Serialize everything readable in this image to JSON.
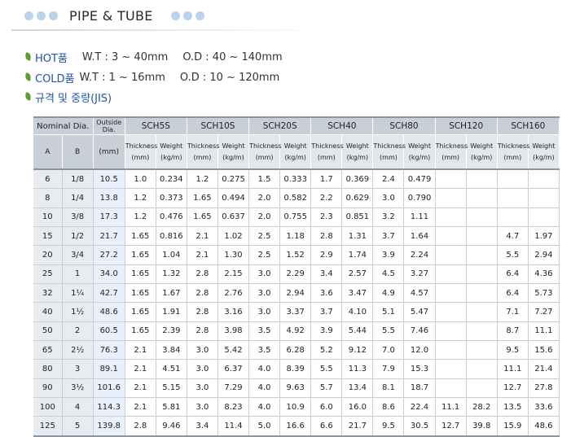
{
  "title": "PIPE & TUBE",
  "specs": {
    "hot": {
      "label": "HOT품",
      "wt": "W.T : 3 ~ 40mm",
      "od": "O.D : 40 ~ 140mm"
    },
    "cold": {
      "label": "COLD품",
      "wt": "W.T : 1 ~ 16mm",
      "od": "O.D : 10 ~ 120mm"
    },
    "jis": {
      "label": "규격 및 중량(JIS)"
    }
  },
  "table": {
    "nominal": "Nominal Dia.",
    "outside": "Outside Dia.",
    "a": "A",
    "b": "B",
    "mm": "(mm)",
    "schedules": [
      "SCH5S",
      "SCH10S",
      "SCH20S",
      "SCH40",
      "SCH80",
      "SCH120",
      "SCH160"
    ],
    "thickness": "Thickness",
    "weight": "Weight",
    "unit_thk": "(mm)",
    "unit_wt": "(kg/m)",
    "rows": [
      [
        "6",
        "1/8",
        "10.5",
        "1.0",
        "0.234",
        "1.2",
        "0.275",
        "1.5",
        "0.333",
        "1.7",
        "0.369",
        "2.4",
        "0.479",
        "",
        "",
        "",
        ""
      ],
      [
        "8",
        "1/4",
        "13.8",
        "1.2",
        "0.373",
        "1.65",
        "0.494",
        "2.0",
        "0.582",
        "2.2",
        "0.629",
        "3.0",
        "0.790",
        "",
        "",
        "",
        ""
      ],
      [
        "10",
        "3/8",
        "17.3",
        "1.2",
        "0.476",
        "1.65",
        "0.637",
        "2.0",
        "0.755",
        "2.3",
        "0.851",
        "3.2",
        "1.11",
        "",
        "",
        "",
        ""
      ],
      [
        "15",
        "1/2",
        "21.7",
        "1.65",
        "0.816",
        "2.1",
        "1.02",
        "2.5",
        "1.18",
        "2.8",
        "1.31",
        "3.7",
        "1.64",
        "",
        "",
        "4.7",
        "1.97"
      ],
      [
        "20",
        "3/4",
        "27.2",
        "1.65",
        "1.04",
        "2.1",
        "1.30",
        "2.5",
        "1.52",
        "2.9",
        "1.74",
        "3.9",
        "2.24",
        "",
        "",
        "5.5",
        "2.94"
      ],
      [
        "25",
        "1",
        "34.0",
        "1.65",
        "1.32",
        "2.8",
        "2.15",
        "3.0",
        "2.29",
        "3.4",
        "2.57",
        "4.5",
        "3.27",
        "",
        "",
        "6.4",
        "4.36"
      ],
      [
        "32",
        "1¼",
        "42.7",
        "1.65",
        "1.67",
        "2.8",
        "2.76",
        "3.0",
        "2.94",
        "3.6",
        "3.47",
        "4.9",
        "4.57",
        "",
        "",
        "6.4",
        "5.73"
      ],
      [
        "40",
        "1½",
        "48.6",
        "1.65",
        "1.91",
        "2.8",
        "3.16",
        "3.0",
        "3.37",
        "3.7",
        "4.10",
        "5.1",
        "5.47",
        "",
        "",
        "7.1",
        "7.27"
      ],
      [
        "50",
        "2",
        "60.5",
        "1.65",
        "2.39",
        "2.8",
        "3.98",
        "3.5",
        "4.92",
        "3.9",
        "5.44",
        "5.5",
        "7.46",
        "",
        "",
        "8.7",
        "11.1"
      ],
      [
        "65",
        "2½",
        "76.3",
        "2.1",
        "3.84",
        "3.0",
        "5.42",
        "3.5",
        "6.28",
        "5.2",
        "9.12",
        "7.0",
        "12.0",
        "",
        "",
        "9.5",
        "15.6"
      ],
      [
        "80",
        "3",
        "89.1",
        "2.1",
        "4.51",
        "3.0",
        "6.37",
        "4.0",
        "8.39",
        "5.5",
        "11.3",
        "7.9",
        "15.3",
        "",
        "",
        "11.1",
        "21.4"
      ],
      [
        "90",
        "3½",
        "101.6",
        "2.1",
        "5.15",
        "3.0",
        "7.29",
        "4.0",
        "9.63",
        "5.7",
        "13.4",
        "8.1",
        "18.7",
        "",
        "",
        "12.7",
        "27.8"
      ],
      [
        "100",
        "4",
        "114.3",
        "2.1",
        "5.81",
        "3.0",
        "8.23",
        "4.0",
        "10.9",
        "6.0",
        "16.0",
        "8.6",
        "22.4",
        "11.1",
        "28.2",
        "13.5",
        "33.6"
      ],
      [
        "125",
        "5",
        "139.8",
        "2.8",
        "9.46",
        "3.4",
        "11.4",
        "5.0",
        "16.6",
        "6.6",
        "21.7",
        "9.5",
        "30.5",
        "12.7",
        "39.8",
        "15.9",
        "48.6"
      ]
    ]
  }
}
